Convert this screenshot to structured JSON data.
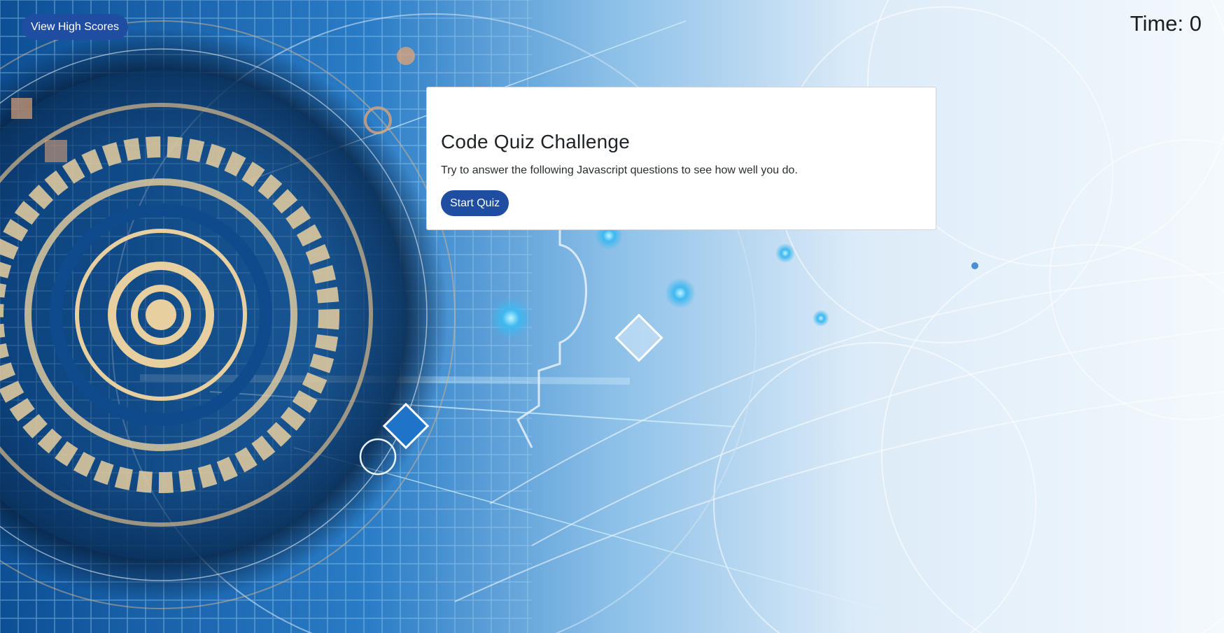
{
  "header": {
    "high_scores_label": "View High Scores",
    "timer_text": "Time: 0"
  },
  "quiz_card": {
    "title": "Code Quiz Challenge",
    "description": "Try to answer the following Javascript questions to see how well you do.",
    "start_label": "Start Quiz"
  },
  "colors": {
    "button_bg": "#1e4da1",
    "page_bg": "#eaf3fb"
  }
}
